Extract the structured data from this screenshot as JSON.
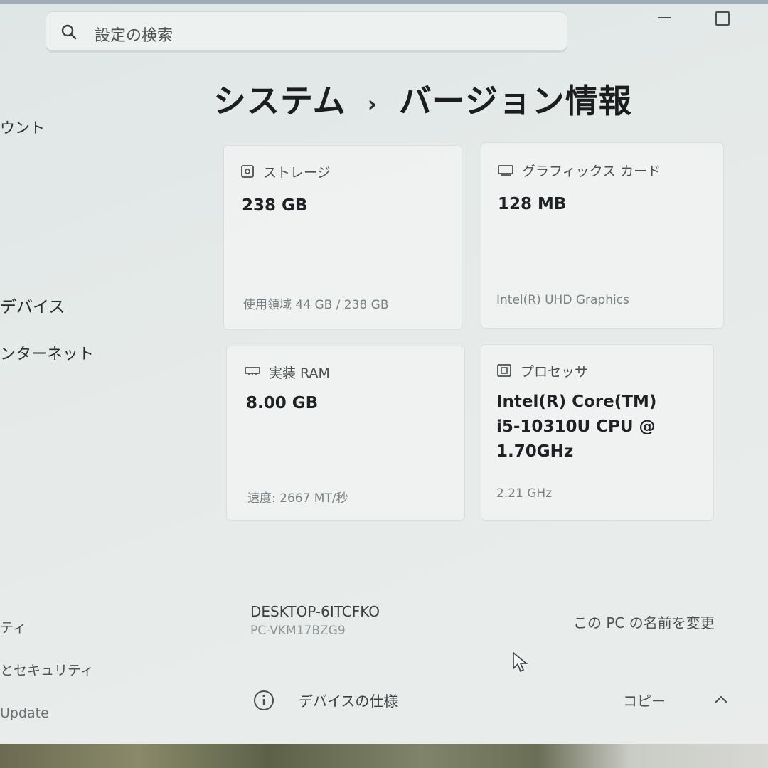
{
  "search": {
    "placeholder": "設定の検索",
    "icon": "search-icon"
  },
  "breadcrumb": {
    "parent": "システム",
    "separator": "›",
    "current": "バージョン情報"
  },
  "sidebar": [
    {
      "label": "ウント"
    },
    {
      "label": "デバイス"
    },
    {
      "label": "ンターネット"
    },
    {
      "label": "ティ"
    },
    {
      "label": "とセキュリティ"
    },
    {
      "label": "Update"
    }
  ],
  "cards": {
    "storage": {
      "label": "ストレージ",
      "value": "238 GB",
      "detail": "使用領域 44 GB / 238 GB",
      "icon": "storage-drive-icon"
    },
    "graphics": {
      "label": "グラフィックス カード",
      "value": "128 MB",
      "detail": "Intel(R) UHD Graphics",
      "icon": "graphics-card-icon"
    },
    "ram": {
      "label": "実装 RAM",
      "value": "8.00 GB",
      "detail": "速度: 2667 MT/秒",
      "icon": "memory-ram-icon"
    },
    "processor": {
      "label": "プロセッサ",
      "value_lines": [
        "Intel(R) Core(TM)",
        "i5-10310U CPU @",
        "1.70GHz"
      ],
      "detail": "2.21 GHz",
      "icon": "processor-chip-icon"
    }
  },
  "device": {
    "name": "DESKTOP-6ITCFKO",
    "model": "PC-VKM17BZG9",
    "rename_label": "この PC の名前を変更"
  },
  "specs": {
    "title": "デバイスの仕様",
    "copy_label": "コピー"
  },
  "colors": {
    "background": "#e4e9e8",
    "card": "#f2f4f3",
    "text": "#1e1e1e"
  }
}
